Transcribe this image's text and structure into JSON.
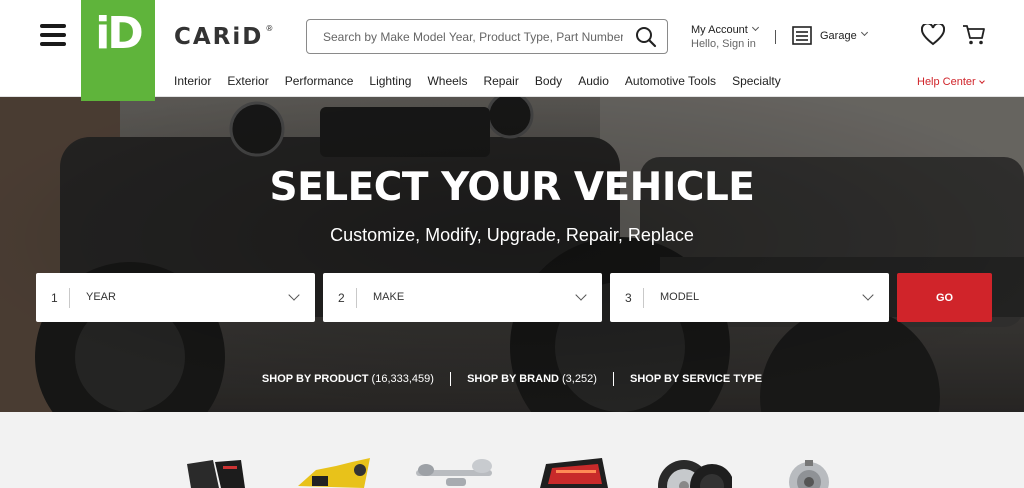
{
  "header": {
    "logo_text": "iD",
    "brand": "CARiD",
    "brand_mark": "®",
    "search_placeholder": "Search by Make Model Year, Product Type, Part Number, or ...",
    "account_title": "My Account",
    "account_sub": "Hello, Sign in",
    "garage_label": "Garage",
    "nav": [
      "Interior",
      "Exterior",
      "Performance",
      "Lighting",
      "Wheels",
      "Repair",
      "Body",
      "Audio",
      "Automotive Tools",
      "Specialty"
    ],
    "help": "Help Center",
    "icons": [
      "hamburger-menu-icon",
      "search-icon",
      "garage-icon",
      "heart-icon",
      "cart-icon"
    ]
  },
  "hero": {
    "title": "SELECT YOUR VEHICLE",
    "subtitle": "Customize, Modify, Upgrade, Repair, Replace",
    "selects": [
      {
        "num": "1",
        "label": "YEAR"
      },
      {
        "num": "2",
        "label": "MAKE"
      },
      {
        "num": "3",
        "label": "MODEL"
      }
    ],
    "go": "GO",
    "shop_product": "SHOP BY PRODUCT",
    "shop_product_count": "(16,333,459)",
    "shop_brand": "SHOP BY BRAND",
    "shop_brand_count": "(3,252)",
    "shop_service": "SHOP BY SERVICE TYPE"
  },
  "categories": [
    "floor-mats-icon",
    "door-kit-icon",
    "exhaust-icon",
    "tail-light-icon",
    "wheel-tire-icon",
    "alternator-icon"
  ],
  "colors": {
    "brand_green": "#5fb43b",
    "accent_red": "#d0242a"
  }
}
